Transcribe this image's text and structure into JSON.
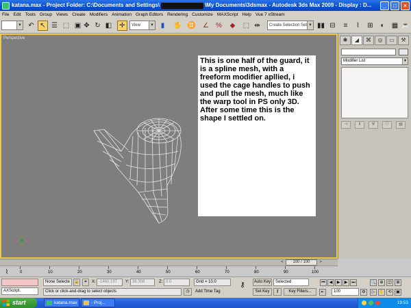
{
  "window": {
    "title_prefix": "katana.max",
    "title_mid": "- Project Folder: C:\\Documents and Settings\\",
    "title_suffix": "\\My Documents\\3dsmax   - Autodesk 3ds Max  2009   - Display : D...",
    "buttons": {
      "minimize": "_",
      "maximize": "□",
      "close": "×"
    }
  },
  "menu": [
    "File",
    "Edit",
    "Tools",
    "Group",
    "Views",
    "Create",
    "Modifiers",
    "Animation",
    "Graph Editors",
    "Rendering",
    "Customize",
    "MAXScript",
    "Help",
    "Vue 7 xStream"
  ],
  "toolbar": {
    "view_combo": "View",
    "selection_set_placeholder": "Create Selection Set"
  },
  "viewport": {
    "label": "Perspective",
    "note": "This is one half of the guard, it is a spline mesh, with a freeform modifier apllied, i used the cage handles to push and pull the mesh, much like the warp tool in PS only 3D.  After some time this is the shape I settled on."
  },
  "command_panel": {
    "modifier_list": "Modifier List"
  },
  "time": {
    "slider_label": "100 / 100",
    "ruler_labels": [
      "0",
      "10",
      "20",
      "30",
      "40",
      "50",
      "60",
      "70",
      "80",
      "90",
      "100"
    ]
  },
  "status": {
    "script_label": "AXScript.",
    "selection": "None Selecte",
    "x_label": "X:",
    "x_value": "-1460.197",
    "y_label": "Y:",
    "y_value": "36.308",
    "z_label": "Z:",
    "z_value": "0.0",
    "grid": "Grid = 10.0",
    "prompt": "Click or click-and-drag to select objects",
    "add_time_tag": "Add Time Tag",
    "auto_key": "Auto Key",
    "set_key": "Set Key",
    "selected": "Selected",
    "key_filters": "Key Filters...",
    "frame": "100"
  },
  "taskbar": {
    "start": "start",
    "tasks": [
      "katana.max",
      "- Proj..."
    ],
    "clock": "19:53"
  }
}
